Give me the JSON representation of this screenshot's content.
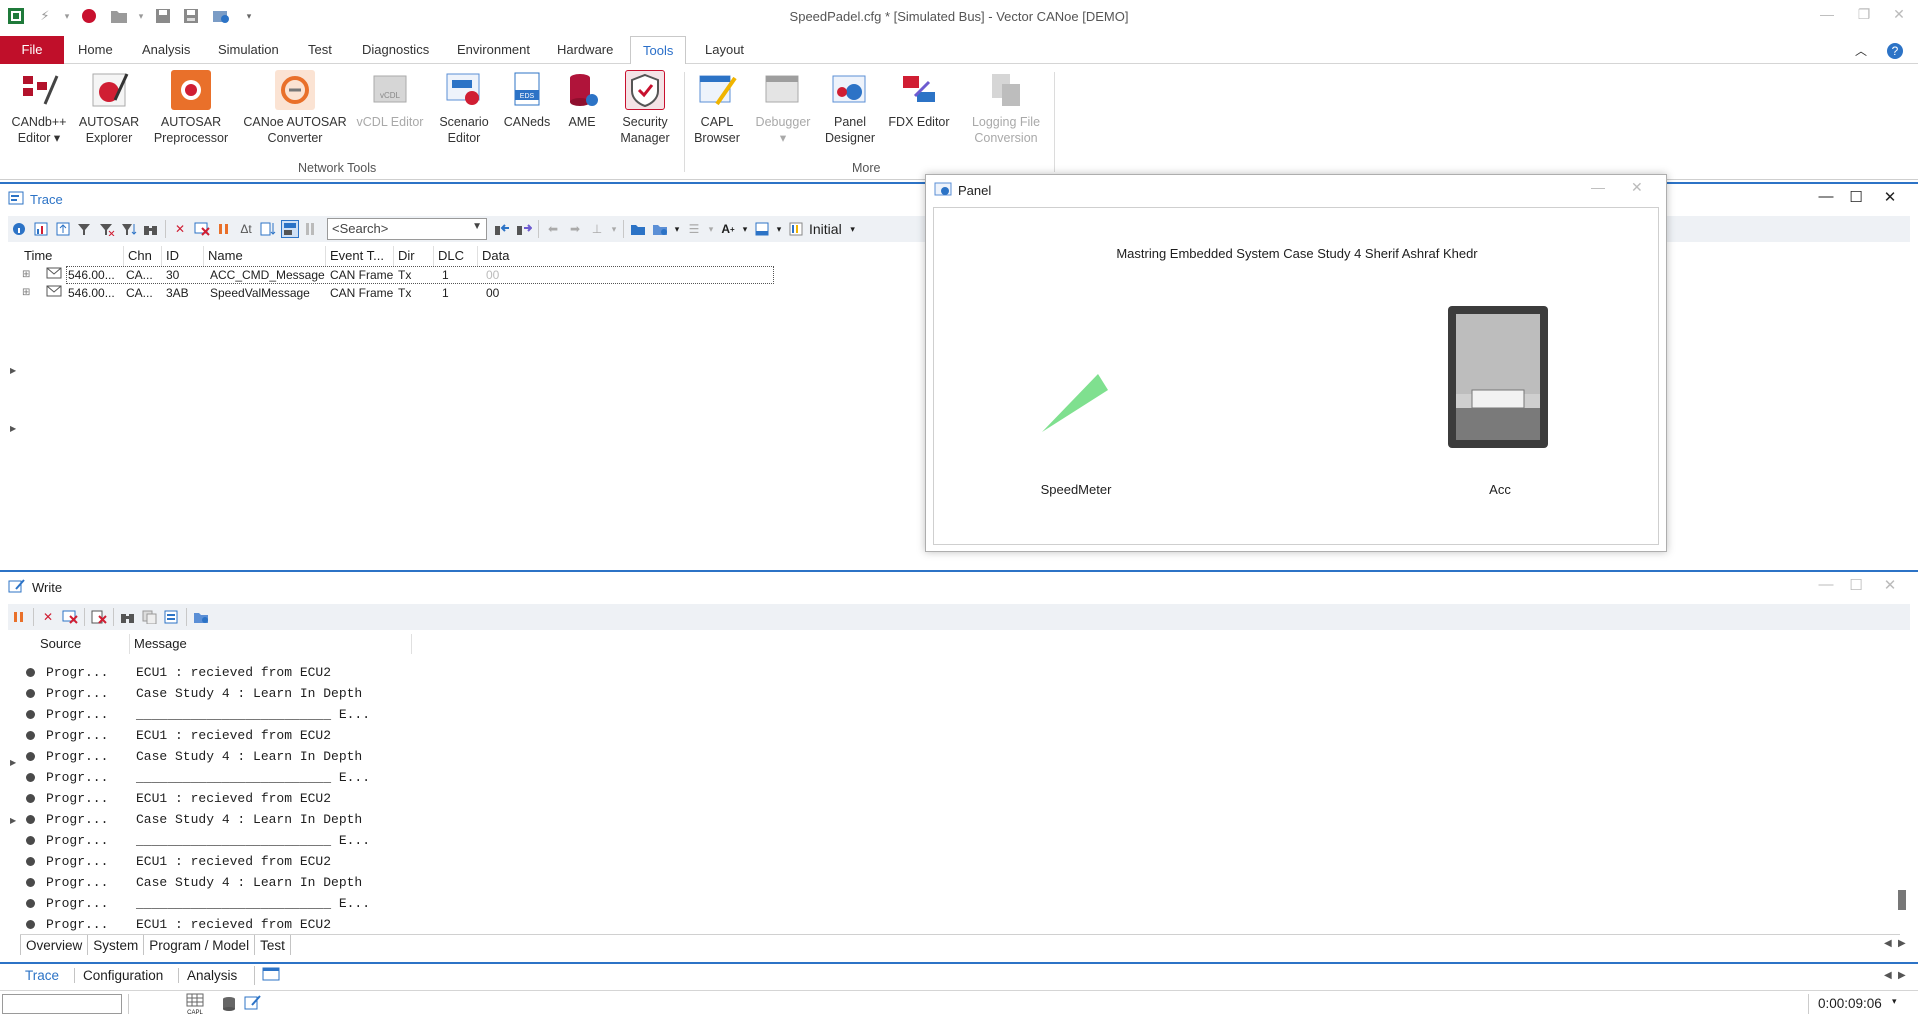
{
  "titlebar": {
    "title": "SpeedPadel.cfg * [Simulated Bus] - Vector CANoe [DEMO]"
  },
  "ribbon_tabs": [
    "File",
    "Home",
    "Analysis",
    "Simulation",
    "Test",
    "Diagnostics",
    "Environment",
    "Hardware",
    "Tools",
    "Layout"
  ],
  "active_tab": "Tools",
  "ribbon": {
    "network_tools": {
      "label": "Network Tools",
      "buttons": [
        {
          "line1": "CANdb++",
          "line2": "Editor ▾"
        },
        {
          "line1": "AUTOSAR",
          "line2": "Explorer"
        },
        {
          "line1": "AUTOSAR",
          "line2": "Preprocessor"
        },
        {
          "line1": "CANoe AUTOSAR",
          "line2": "Converter"
        },
        {
          "line1": "vCDL Editor",
          "line2": ""
        },
        {
          "line1": "Scenario",
          "line2": "Editor"
        },
        {
          "line1": "CANeds",
          "line2": ""
        },
        {
          "line1": "AME",
          "line2": ""
        },
        {
          "line1": "Security",
          "line2": "Manager"
        }
      ]
    },
    "more": {
      "label": "More",
      "buttons": [
        {
          "line1": "CAPL",
          "line2": "Browser"
        },
        {
          "line1": "Debugger",
          "line2": "▾"
        },
        {
          "line1": "Panel",
          "line2": "Designer"
        },
        {
          "line1": "FDX Editor",
          "line2": ""
        },
        {
          "line1": "Logging File",
          "line2": "Conversion"
        }
      ]
    }
  },
  "trace": {
    "title": "Trace",
    "search_placeholder": "<Search>",
    "layout_label": "Initial",
    "columns": [
      "Time",
      "Chn",
      "ID",
      "Name",
      "Event T...",
      "Dir",
      "DLC",
      "Data"
    ],
    "rows": [
      {
        "time": "546.00...",
        "chn": "CA...",
        "id": "30",
        "name": "ACC_CMD_Message",
        "event": "CAN Frame",
        "dir": "Tx",
        "dlc": "1",
        "data": "00"
      },
      {
        "time": "546.00...",
        "chn": "CA...",
        "id": "3AB",
        "name": "SpeedValMessage",
        "event": "CAN Frame",
        "dir": "Tx",
        "dlc": "1",
        "data": "00"
      }
    ]
  },
  "panel": {
    "title": "Panel",
    "heading": "Mastring Embedded System Case Study 4 Sherif Ashraf Khedr",
    "speedmeter_label": "SpeedMeter",
    "acc_label": "Acc"
  },
  "write": {
    "title": "Write",
    "columns": [
      "Source",
      "Message"
    ],
    "rows": [
      {
        "source": "Progr...",
        "message": "ECU1 : recieved from ECU2"
      },
      {
        "source": "Progr...",
        "message": "Case Study 4 : Learn In Depth"
      },
      {
        "source": "Progr...",
        "message": "_________________________ E..."
      },
      {
        "source": "Progr...",
        "message": "ECU1 : recieved from ECU2"
      },
      {
        "source": "Progr...",
        "message": "Case Study 4 : Learn In Depth"
      },
      {
        "source": "Progr...",
        "message": "_________________________ E..."
      },
      {
        "source": "Progr...",
        "message": "ECU1 : recieved from ECU2"
      },
      {
        "source": "Progr...",
        "message": "Case Study 4 : Learn In Depth"
      },
      {
        "source": "Progr...",
        "message": "_________________________ E..."
      },
      {
        "source": "Progr...",
        "message": "ECU1 : recieved from ECU2"
      },
      {
        "source": "Progr...",
        "message": "Case Study 4 : Learn In Depth"
      },
      {
        "source": "Progr...",
        "message": "_________________________ E..."
      },
      {
        "source": "Progr...",
        "message": "ECU1 : recieved from ECU2"
      }
    ],
    "subtabs": [
      "Overview",
      "System",
      "Program / Model",
      "Test"
    ]
  },
  "doc_tabs": [
    "Trace",
    "Configuration",
    "Analysis"
  ],
  "status": {
    "capl_label": "CAPL",
    "time": "0:00:09:06"
  },
  "colors": {
    "accent_blue": "#2c73c6",
    "file_tab_red": "#c00f2a",
    "speed_needle_green": "#7fe08f"
  }
}
